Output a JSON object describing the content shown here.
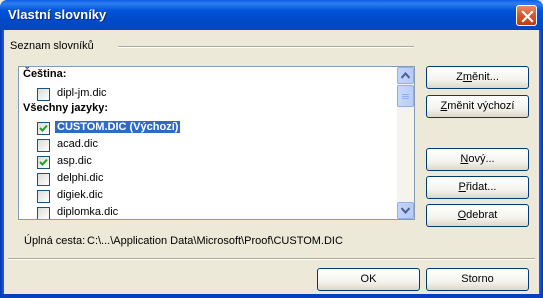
{
  "window": {
    "title": "Vlastní slovníky"
  },
  "group": {
    "label": "Seznam slovníků"
  },
  "list": {
    "rows": [
      {
        "type": "header",
        "label": "Čeština:"
      },
      {
        "type": "item",
        "label": "dipl-jm.dic",
        "checked": false
      },
      {
        "type": "header",
        "label": "Všechny jazyky:"
      },
      {
        "type": "item",
        "label": "CUSTOM.DIC (Výchozí)",
        "checked": true,
        "selected": true
      },
      {
        "type": "item",
        "label": "acad.dic",
        "checked": false
      },
      {
        "type": "item",
        "label": "asp.dic",
        "checked": true
      },
      {
        "type": "item",
        "label": "delphi.dic",
        "checked": false
      },
      {
        "type": "item",
        "label": "digiek.dic",
        "checked": false
      },
      {
        "type": "item",
        "label": "diplomka.dic",
        "checked": false
      }
    ]
  },
  "buttons": {
    "change": {
      "pre": "Z",
      "u": "m",
      "post": "ěnit..."
    },
    "change_default": {
      "pre": "",
      "u": "Z",
      "post": "měnit výchozí"
    },
    "new": {
      "pre": "",
      "u": "N",
      "post": "ový..."
    },
    "add": {
      "pre": "",
      "u": "P",
      "post": "řidat..."
    },
    "remove": {
      "pre": "",
      "u": "O",
      "post": "debrat"
    },
    "ok": "OK",
    "cancel": "Storno"
  },
  "path": {
    "label": "Úplná cesta:",
    "value": "C:\\...\\Application Data\\Microsoft\\Proof\\CUSTOM.DIC"
  },
  "colors": {
    "titlebar": "#0052D9",
    "selection": "#316AC5",
    "dialog_bg": "#ECE9D8"
  }
}
